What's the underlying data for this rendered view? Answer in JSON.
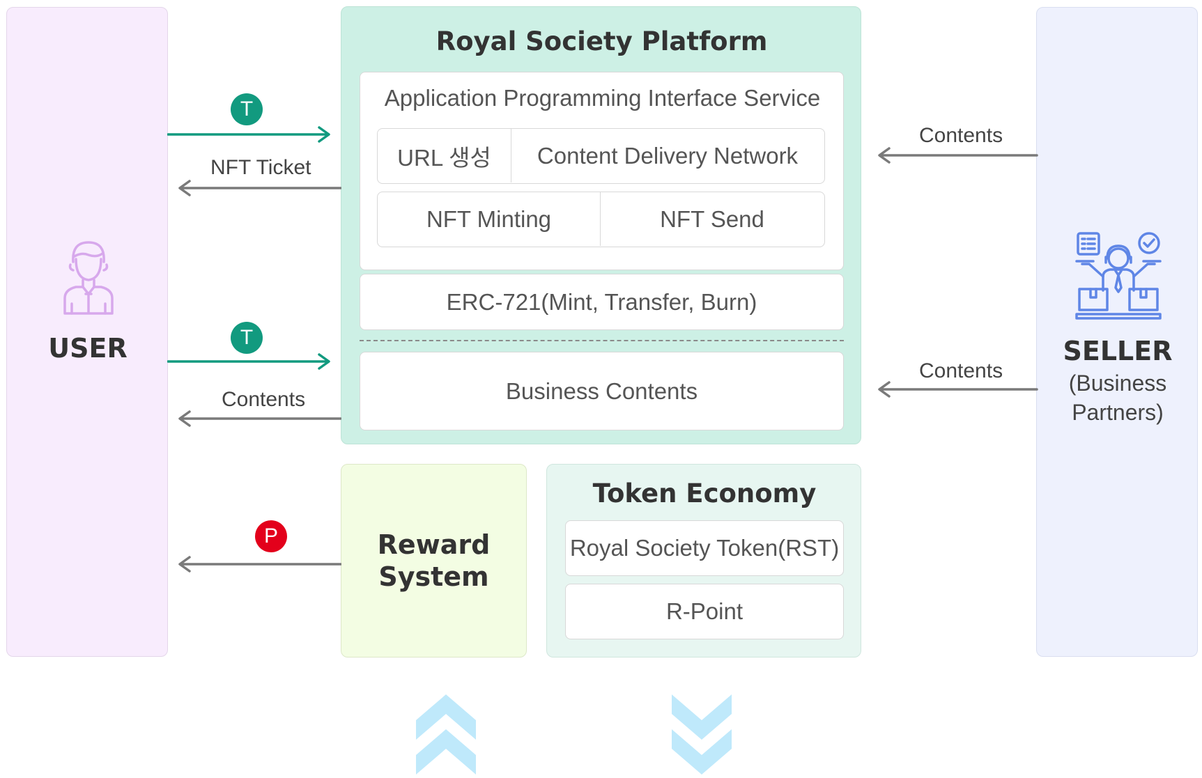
{
  "user": {
    "label": "USER"
  },
  "seller": {
    "label": "SELLER",
    "sublabel_1": "(Business",
    "sublabel_2": "Partners)"
  },
  "platform": {
    "title": "Royal Society Platform",
    "api": {
      "title": "Application Programming Interface Service",
      "url_gen": "URL 생성",
      "cdn": "Content Delivery Network",
      "nft_minting": "NFT Minting",
      "nft_send": "NFT Send"
    },
    "erc": "ERC-721(Mint, Transfer, Burn)",
    "business": "Business Contents"
  },
  "reward": {
    "line1": "Reward",
    "line2": "System"
  },
  "token": {
    "title": "Token Economy",
    "rst": "Royal Society Token(RST)",
    "rpoint": "R-Point"
  },
  "edges": {
    "user_to_platform_badge_1": "T",
    "nft_ticket": "NFT Ticket",
    "user_to_platform_badge_2": "T",
    "contents_to_user": "Contents",
    "reward_badge": "P",
    "seller_contents_1": "Contents",
    "seller_contents_2": "Contents"
  },
  "colors": {
    "teal": "#129a7f",
    "gray_arrow": "#7a7a7a",
    "red_badge": "#e3001b",
    "icon_user": "#d7a8ec",
    "icon_seller": "#5f86e6",
    "chevron": "#bfe9fb"
  },
  "icons": {
    "user": "user-icon",
    "seller": "seller-icon",
    "up": "double-chevron-up-icon",
    "down": "double-chevron-down-icon"
  }
}
